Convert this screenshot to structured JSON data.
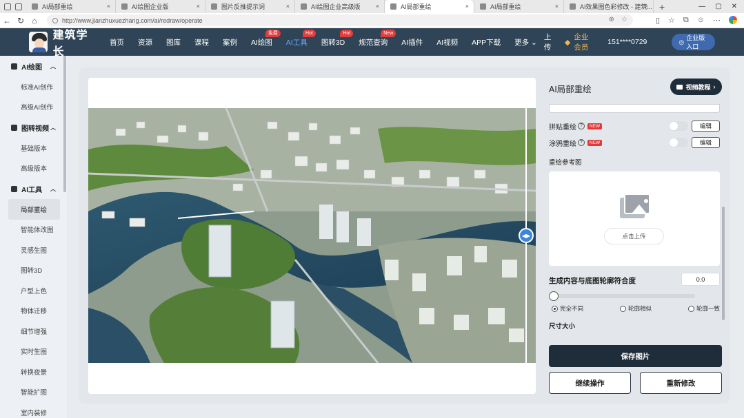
{
  "browser": {
    "tabs": [
      {
        "label": "AI局部重绘"
      },
      {
        "label": "AI绘图企业版"
      },
      {
        "label": "图片反推提示词"
      },
      {
        "label": "AI绘图企业高级版"
      },
      {
        "label": "AI局部重绘"
      },
      {
        "label": "AI局部重绘"
      },
      {
        "label": "AI效果图色彩修改 - 建筑..."
      }
    ],
    "active_tab": 4,
    "url": "http://www.jianzhuxuezhang.com/ai/redraw/operate"
  },
  "header": {
    "brand": "建筑学长",
    "nav": [
      {
        "label": "首页"
      },
      {
        "label": "资源"
      },
      {
        "label": "图库"
      },
      {
        "label": "课程"
      },
      {
        "label": "案例"
      },
      {
        "label": "AI绘图",
        "badge": "免费"
      },
      {
        "label": "AI工具",
        "badge": "Hot",
        "current": true
      },
      {
        "label": "图转3D",
        "badge": "Hot"
      },
      {
        "label": "规范查询",
        "badge": "New"
      },
      {
        "label": "AI插件"
      },
      {
        "label": "AI视频"
      },
      {
        "label": "APP下载"
      },
      {
        "label": "更多 ⌄"
      }
    ],
    "upload": "上传",
    "vip": "企业会员",
    "phone": "151****0729",
    "enterprise_btn": "企业版入口"
  },
  "sidebar": {
    "groups": [
      {
        "title": "AI绘图",
        "items": [
          "标准AI创作",
          "高级AI创作"
        ]
      },
      {
        "title": "图转视频",
        "items": [
          "基础版本",
          "高级版本"
        ]
      },
      {
        "title": "AI工具",
        "items": [
          "局部重绘",
          "智能体改图",
          "灵感生图",
          "图转3D",
          "户型上色",
          "物体迁移",
          "细节增强",
          "实时生图",
          "转换夜景",
          "智能扩图",
          "室内装修"
        ]
      }
    ],
    "active_item": "局部重绘"
  },
  "panel": {
    "title": "AI局部重绘",
    "video_btn": "视频教程",
    "options": [
      {
        "label": "拼贴重绘",
        "badge": "NEW",
        "edit": "编辑"
      },
      {
        "label": "涂鸦重绘",
        "badge": "NEW",
        "edit": "编辑"
      }
    ],
    "ref_label": "重绘参考图",
    "upload_btn": "点击上传",
    "match_label": "生成内容与底图轮廓符合度",
    "match_value": "0.0",
    "match_level": 0.0,
    "radios": [
      {
        "label": "完全不同",
        "checked": true
      },
      {
        "label": "轮廓相似",
        "checked": false
      },
      {
        "label": "轮廓一致",
        "checked": false
      }
    ],
    "size_label": "尺寸大小",
    "save": "保存图片",
    "continue": "继续操作",
    "redo": "重新修改"
  },
  "colors": {
    "header_bg": "#2f4456",
    "accent_blue": "#3d86e0",
    "dark_button": "#1f2d3a",
    "badge_red": "#e33c3c",
    "vip_gold": "#f2b45a"
  }
}
